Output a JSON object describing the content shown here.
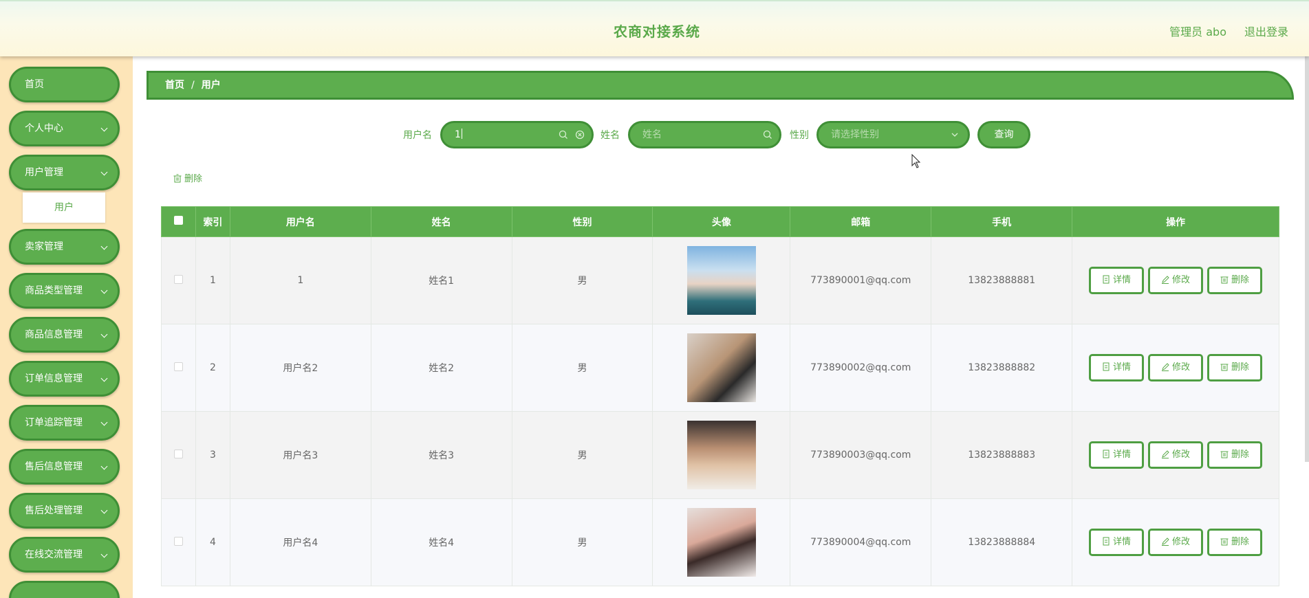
{
  "header": {
    "title": "农商对接系统",
    "admin": "管理员 abo",
    "logout": "退出登录"
  },
  "sidebar": {
    "items": [
      {
        "label": "首页",
        "expandable": false
      },
      {
        "label": "个人中心",
        "expandable": true
      },
      {
        "label": "用户管理",
        "expandable": true
      },
      {
        "label": "卖家管理",
        "expandable": true
      },
      {
        "label": "商品类型管理",
        "expandable": true
      },
      {
        "label": "商品信息管理",
        "expandable": true
      },
      {
        "label": "订单信息管理",
        "expandable": true
      },
      {
        "label": "订单追踪管理",
        "expandable": true
      },
      {
        "label": "售后信息管理",
        "expandable": true
      },
      {
        "label": "售后处理管理",
        "expandable": true
      },
      {
        "label": "在线交流管理",
        "expandable": true
      }
    ],
    "submenu": {
      "label": "用户"
    }
  },
  "breadcrumb": {
    "home": "首页",
    "separator": "/",
    "current": "用户"
  },
  "search": {
    "username_label": "用户名",
    "username_value": "1",
    "name_label": "姓名",
    "name_placeholder": "姓名",
    "gender_label": "性别",
    "gender_placeholder": "请选择性别",
    "query_button": "查询"
  },
  "actions": {
    "delete": "删除"
  },
  "table": {
    "headers": [
      "索引",
      "用户名",
      "姓名",
      "性别",
      "头像",
      "邮箱",
      "手机",
      "操作"
    ],
    "ops": {
      "detail": "详情",
      "edit": "修改",
      "delete": "删除"
    },
    "rows": [
      {
        "index": "1",
        "username": "1",
        "name": "姓名1",
        "gender": "男",
        "avatar": "avatar-photo",
        "email": "773890001@qq.com",
        "phone": "13823888881"
      },
      {
        "index": "2",
        "username": "用户名2",
        "name": "姓名2",
        "gender": "男",
        "avatar": "avatar-photo",
        "email": "773890002@qq.com",
        "phone": "13823888882"
      },
      {
        "index": "3",
        "username": "用户名3",
        "name": "姓名3",
        "gender": "男",
        "avatar": "avatar-photo",
        "email": "773890003@qq.com",
        "phone": "13823888883"
      },
      {
        "index": "4",
        "username": "用户名4",
        "name": "姓名4",
        "gender": "男",
        "avatar": "avatar-photo",
        "email": "773890004@qq.com",
        "phone": "13823888884"
      }
    ]
  },
  "colors": {
    "primary": "#5dae4e",
    "primary_dark": "#3f8f36",
    "sidebar_bg": "#fde5b8",
    "text_green": "#5aa94a"
  }
}
